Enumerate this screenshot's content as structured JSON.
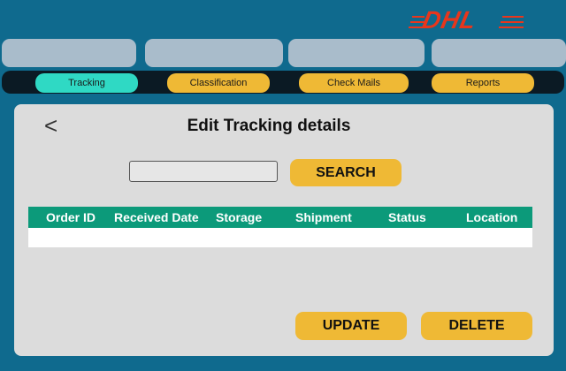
{
  "brand": {
    "logo_text": "DHL",
    "logo_color": "#e8361c"
  },
  "nav": {
    "items": [
      {
        "label": "Tracking",
        "active": true
      },
      {
        "label": "Classification",
        "active": false
      },
      {
        "label": "Check Mails",
        "active": false
      },
      {
        "label": "Reports",
        "active": false
      }
    ]
  },
  "page": {
    "back_icon": "chevron-left-icon",
    "back_glyph": "<",
    "title": "Edit Tracking details"
  },
  "search": {
    "value": "",
    "button_label": "SEARCH"
  },
  "table": {
    "columns": [
      "Order ID",
      "Received Date",
      "Storage",
      "Shipment",
      "Status",
      "Location"
    ],
    "rows": []
  },
  "actions": {
    "update_label": "UPDATE",
    "delete_label": "DELETE"
  },
  "colors": {
    "background": "#0f6a8e",
    "accent_yellow": "#efb935",
    "active_teal": "#2fd9c4",
    "table_header": "#0c9a7a",
    "panel": "#dcdcdc"
  }
}
